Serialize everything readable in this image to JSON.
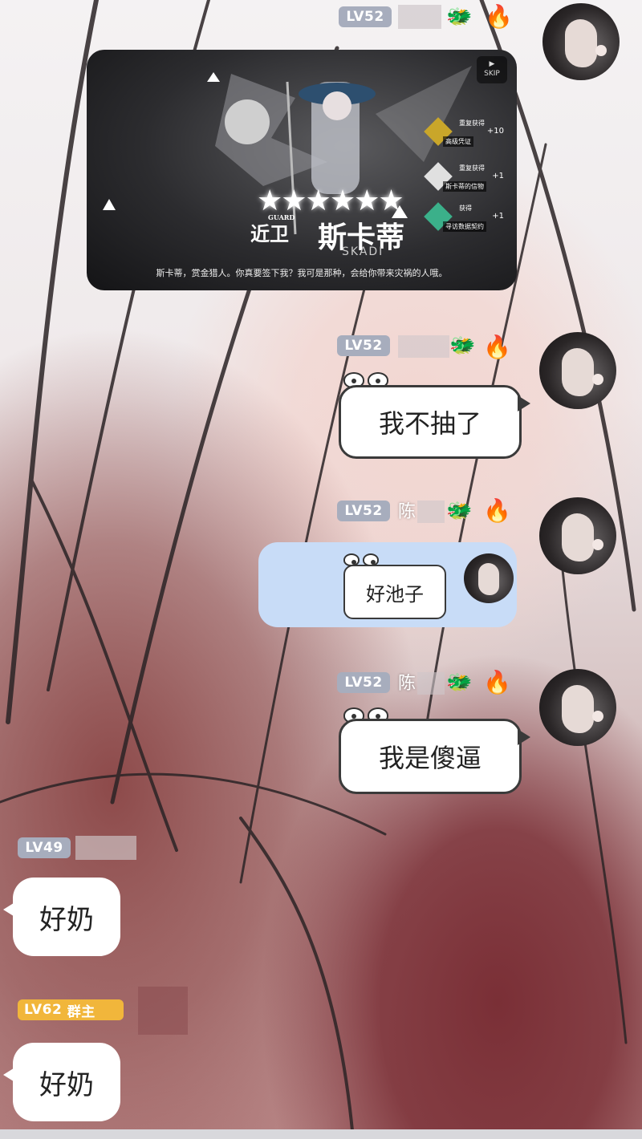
{
  "messages": [
    {
      "level": "LV52",
      "sender": "",
      "type": "image",
      "game_card": {
        "skip_label": "SKIP",
        "class_label": "GUARD",
        "class_cn": "近卫",
        "stars": "★★★★★★",
        "char_name": "斯卡蒂",
        "char_en": "SKADI",
        "caption": "斯卡蒂，赏金猎人。你真要签下我？我可是那种，会给你带来灾祸的人哦。",
        "rewards": [
          {
            "title": "重复获得",
            "count": "+10",
            "label": "高级凭证"
          },
          {
            "title": "重复获得",
            "count": "+1",
            "label": "斯卡蒂的信物"
          },
          {
            "title": "获得",
            "count": "+1",
            "label": "寻访数据契约"
          }
        ]
      }
    },
    {
      "level": "LV52",
      "sender": "",
      "type": "text",
      "text": "我不抽了"
    },
    {
      "level": "LV52",
      "sender": "陈",
      "type": "text",
      "text": "好池子"
    },
    {
      "level": "LV52",
      "sender": "陈",
      "type": "text",
      "text": "我是傻逼"
    },
    {
      "level": "LV49",
      "sender": "",
      "type": "text",
      "text": "好奶"
    },
    {
      "level": "LV62",
      "role": "群主",
      "sender": "",
      "type": "text",
      "text": "好奶"
    }
  ],
  "colors": {
    "level_badge": "#a7adbd",
    "owner_badge": "#f1b63b",
    "highlight_bubble": "#c8dcf7"
  },
  "icons": [
    "fire-icon",
    "dragon-badge-icon",
    "avatar"
  ]
}
